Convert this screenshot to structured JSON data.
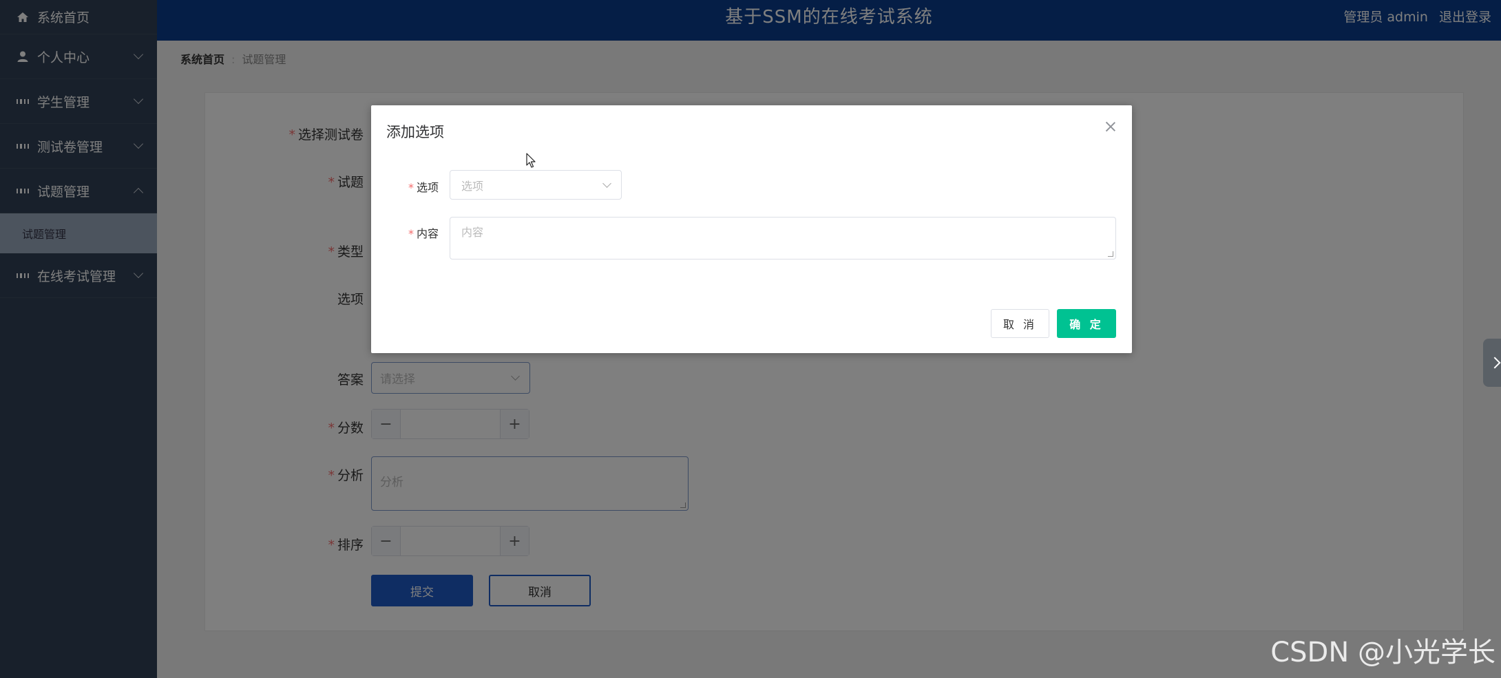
{
  "app": {
    "title": "基于SSM的在线考试系统",
    "user_label": "管理员 admin",
    "logout_label": "退出登录"
  },
  "sidebar": {
    "items": [
      {
        "label": "系统首页",
        "icon": "home-icon"
      },
      {
        "label": "个人中心",
        "icon": "user-icon"
      },
      {
        "label": "学生管理",
        "icon": "grid-icon"
      },
      {
        "label": "测试卷管理",
        "icon": "grid-icon"
      },
      {
        "label": "试题管理",
        "icon": "grid-icon"
      },
      {
        "label": "在线考试管理",
        "icon": "grid-icon"
      }
    ],
    "active_sub": "试题管理"
  },
  "breadcrumb": {
    "home": "系统首页",
    "current": "试题管理"
  },
  "form": {
    "paper_label": "选择测试卷",
    "question_label": "试题",
    "type_label": "类型",
    "options_label": "选项",
    "answer_label": "答案",
    "answer_placeholder": "请选择",
    "score_label": "分数",
    "analysis_label": "分析",
    "analysis_placeholder": "分析",
    "order_label": "排序",
    "submit_label": "提交",
    "cancel_label": "取消"
  },
  "dialog": {
    "title": "添加选项",
    "option_label": "选项",
    "option_placeholder": "选项",
    "content_label": "内容",
    "content_placeholder": "内容",
    "cancel_label": "取 消",
    "ok_label": "确 定"
  },
  "watermark": "CSDN @小光学长",
  "colors": {
    "sidebar": "#304156",
    "header": "#0a3d8c",
    "confirm": "#00c292",
    "submit": "#1e5bc6",
    "required": "#f56c6c"
  }
}
